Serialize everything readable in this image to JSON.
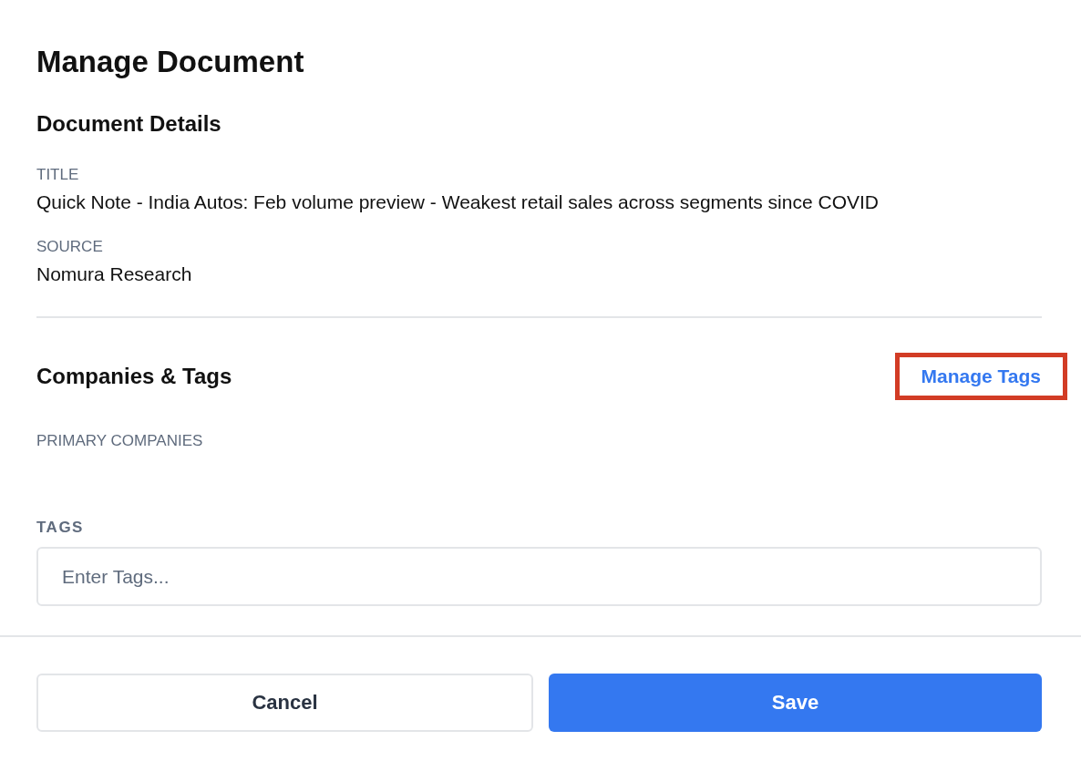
{
  "dialog": {
    "title": "Manage Document"
  },
  "details": {
    "heading": "Document Details",
    "fields": [
      {
        "label": "TITLE",
        "value": "Quick Note - India Autos: Feb volume preview - Weakest retail sales across segments since COVID"
      },
      {
        "label": "SOURCE",
        "value": "Nomura Research"
      }
    ]
  },
  "companies": {
    "heading": "Companies & Tags",
    "manage_link": {
      "label": "Manage Tags",
      "highlighted": true
    },
    "primary_label": "PRIMARY COMPANIES",
    "tags_label": "TAGS",
    "tags_field": {
      "placeholder": "Enter Tags..."
    }
  },
  "buttons": [
    {
      "label": "Cancel",
      "kind": "secondary"
    },
    {
      "label": "Save",
      "kind": "primary"
    }
  ]
}
